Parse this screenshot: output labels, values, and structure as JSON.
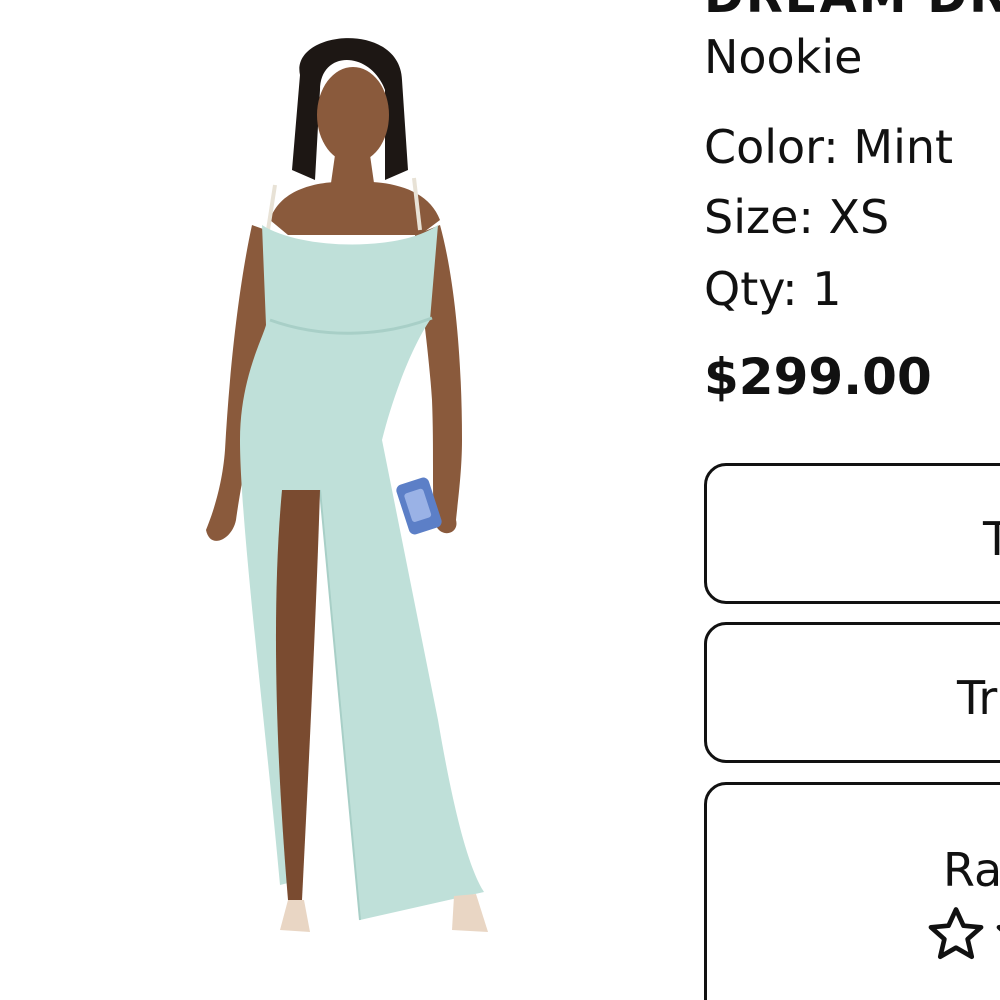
{
  "product": {
    "title": "DREAM DR",
    "brand": "Nookie",
    "color_line": "Color: Mint",
    "size_line": "Size: XS",
    "qty_line": "Qty: 1",
    "price": "$299.00",
    "dress_color": "#bfe0d9"
  },
  "actions": [
    {
      "label": "T"
    },
    {
      "label": "Tr"
    },
    {
      "label": "Ra",
      "rating_stars": 2
    }
  ],
  "icons": {
    "star": "star-outline-icon"
  }
}
